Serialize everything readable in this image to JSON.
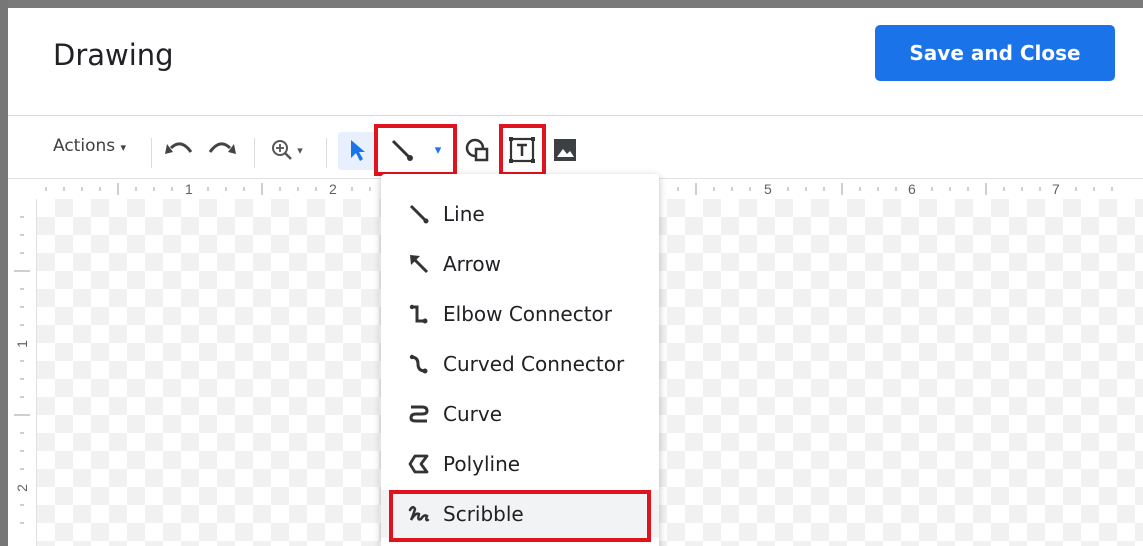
{
  "window": {
    "title": "Drawing"
  },
  "header": {
    "save_label": "Save and Close"
  },
  "toolbar": {
    "actions_label": "Actions",
    "items": [
      "undo-icon",
      "redo-icon",
      "zoom-icon",
      "select-icon",
      "line-icon",
      "shape-icon",
      "text-box-icon",
      "image-icon"
    ]
  },
  "ruler": {
    "top_numbers": [
      "1",
      "2",
      "5",
      "6",
      "7"
    ],
    "left_numbers": [
      "1",
      "2"
    ]
  },
  "line_menu": {
    "items": [
      {
        "label": "Line",
        "icon": "line-icon"
      },
      {
        "label": "Arrow",
        "icon": "arrow-icon"
      },
      {
        "label": "Elbow Connector",
        "icon": "elbow-connector-icon"
      },
      {
        "label": "Curved Connector",
        "icon": "curved-connector-icon"
      },
      {
        "label": "Curve",
        "icon": "curve-icon"
      },
      {
        "label": "Polyline",
        "icon": "polyline-icon"
      },
      {
        "label": "Scribble",
        "icon": "scribble-icon"
      }
    ]
  },
  "colors": {
    "accent": "#1a73e8",
    "highlight": "#e0141e",
    "select_bg": "#e8f0fe"
  }
}
